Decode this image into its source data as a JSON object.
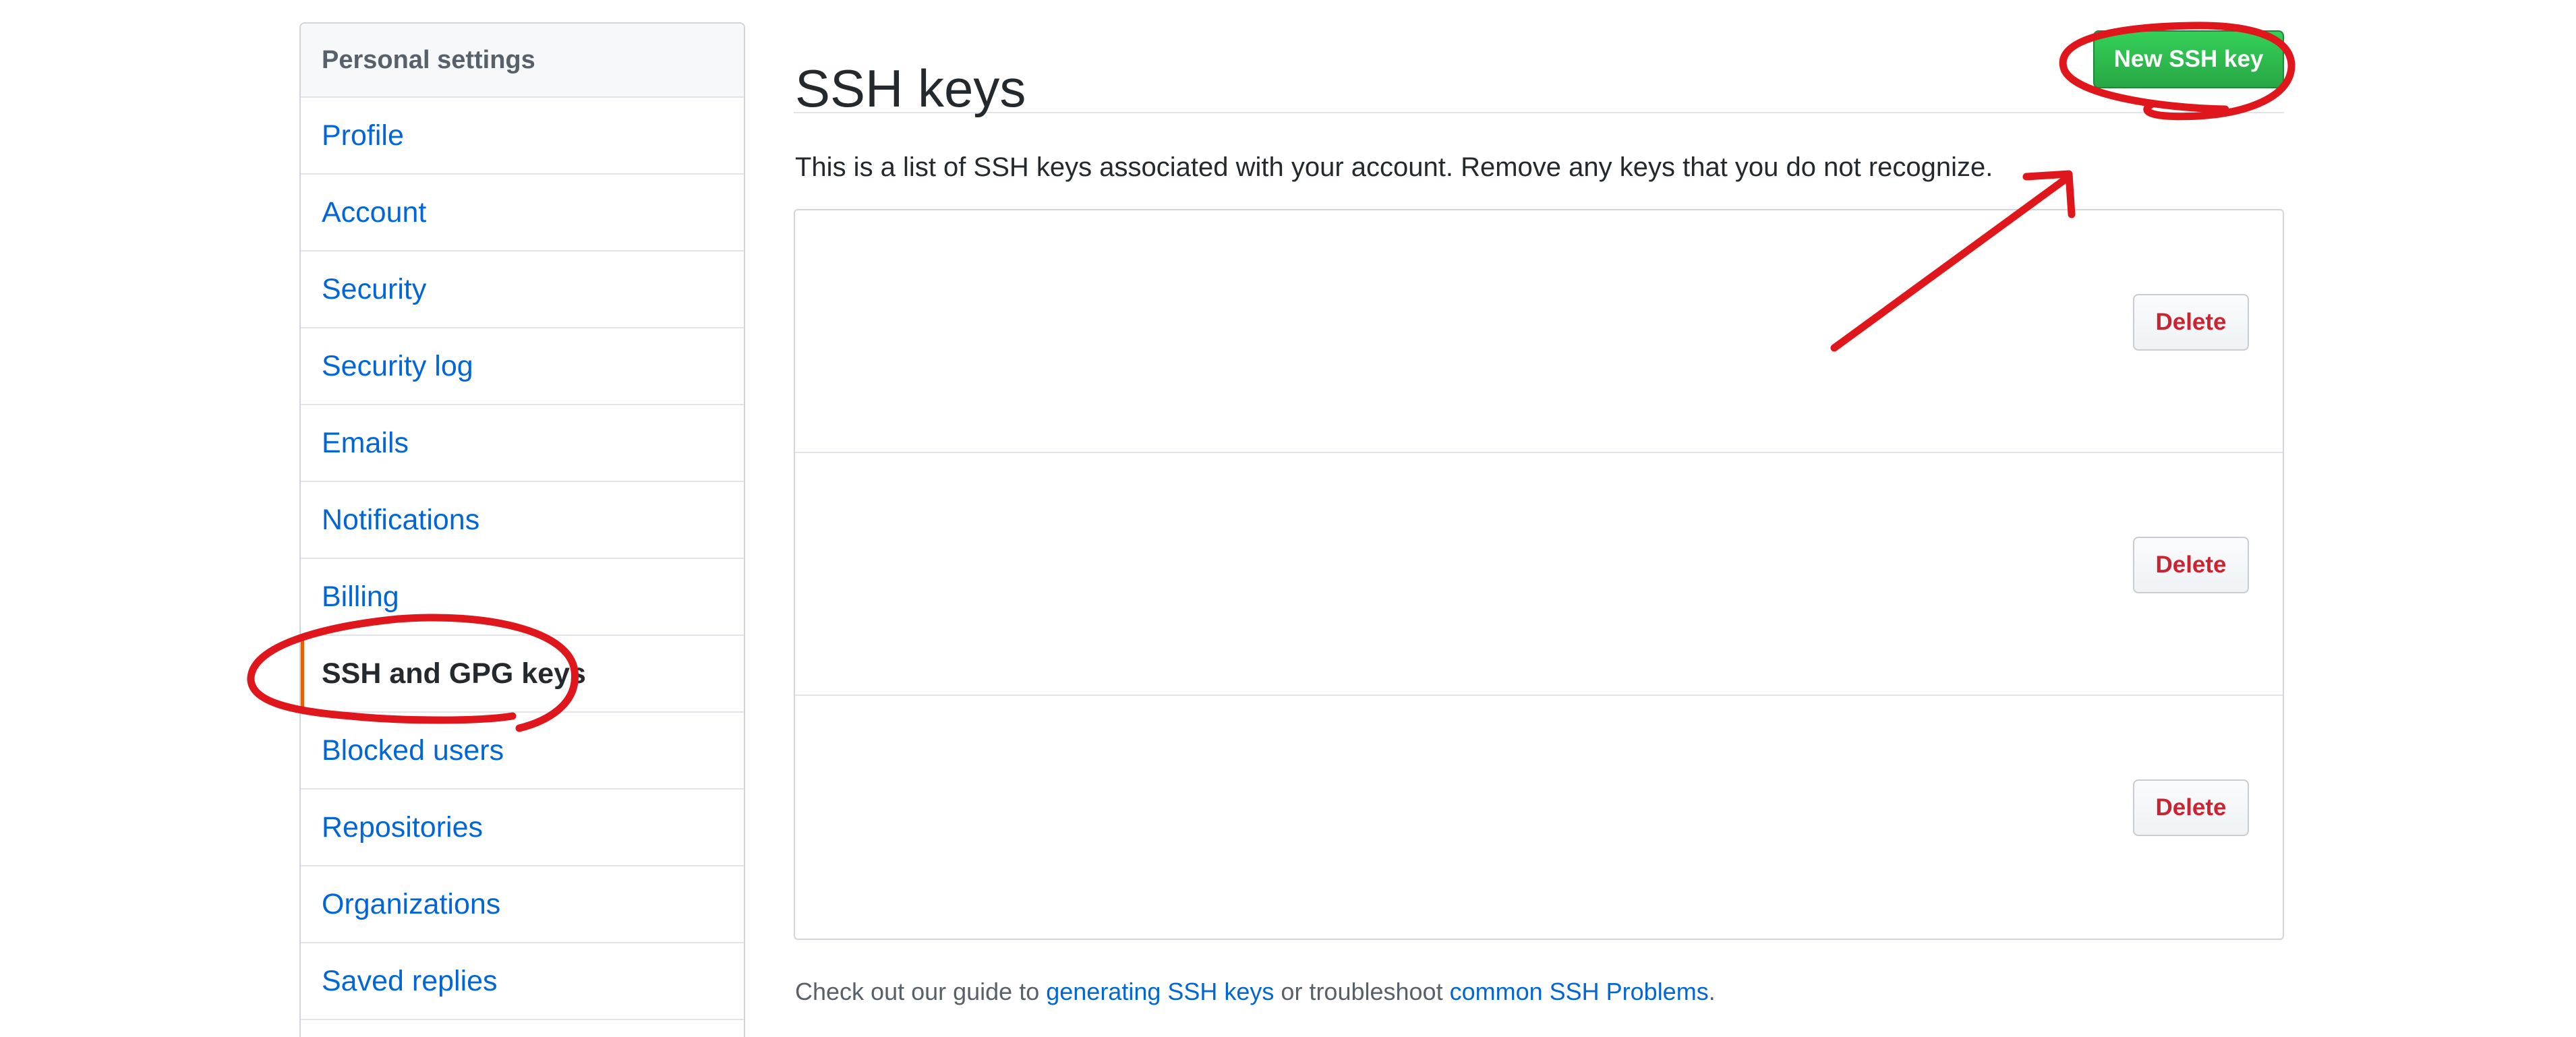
{
  "sidebar": {
    "header": "Personal settings",
    "items": [
      {
        "label": "Profile"
      },
      {
        "label": "Account"
      },
      {
        "label": "Security"
      },
      {
        "label": "Security log"
      },
      {
        "label": "Emails"
      },
      {
        "label": "Notifications"
      },
      {
        "label": "Billing"
      },
      {
        "label": "SSH and GPG keys",
        "selected": true
      },
      {
        "label": "Blocked users"
      },
      {
        "label": "Repositories"
      },
      {
        "label": "Organizations"
      },
      {
        "label": "Saved replies"
      }
    ]
  },
  "main": {
    "title": "SSH keys",
    "new_key_label": "New SSH key",
    "description": "This is a list of SSH keys associated with your account. Remove any keys that you do not recognize.",
    "keys": [
      {
        "delete_label": "Delete"
      },
      {
        "delete_label": "Delete"
      },
      {
        "delete_label": "Delete"
      }
    ],
    "footer": {
      "prefix": "Check out our guide to ",
      "link1": "generating SSH keys",
      "middle": " or troubleshoot ",
      "link2": "common SSH Problems",
      "suffix": "."
    }
  },
  "colors": {
    "link": "#0366d6",
    "primary_button": "#28a745",
    "danger_text": "#cb2431",
    "selected_indicator": "#e36209",
    "annotation": "#e0161d"
  }
}
